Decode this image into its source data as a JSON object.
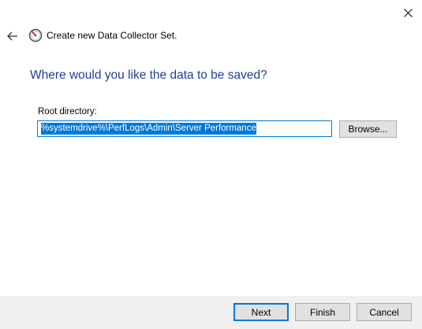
{
  "window": {
    "title": "Create new Data Collector Set."
  },
  "page": {
    "heading": "Where would you like the data to be saved?",
    "root_directory_label": "Root directory:",
    "root_directory_value": "%systemdrive%\\PerfLogs\\Admin\\Server Performance",
    "browse_label": "Browse..."
  },
  "footer": {
    "next_label": "Next",
    "finish_label": "Finish",
    "cancel_label": "Cancel"
  },
  "icons": {
    "close": "close-icon",
    "back": "back-arrow-icon",
    "app": "performance-monitor-icon"
  },
  "colors": {
    "heading": "#1f3f9a",
    "accent": "#0078d7",
    "footer_bg": "#f0f0f0"
  }
}
